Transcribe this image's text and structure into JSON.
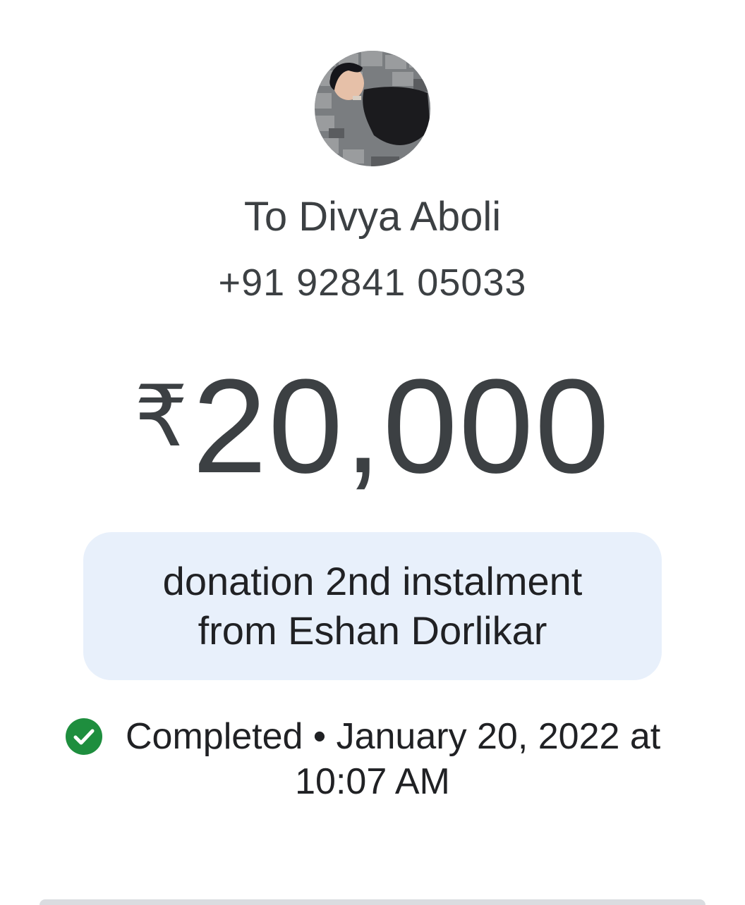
{
  "recipient": {
    "label": "To Divya Aboli",
    "phone": "+91 92841 05033"
  },
  "payment": {
    "currency_symbol": "₹",
    "amount": "20,000",
    "note": "donation 2nd instalment\nfrom Eshan Dorlikar"
  },
  "status": {
    "icon": "check-circle-icon",
    "line1": "Completed • January 20, 2022 at",
    "line2": "10:07 AM",
    "color": "#1e8e3e"
  },
  "colors": {
    "note_background": "#e8f0fb",
    "text": "#3c4043"
  }
}
